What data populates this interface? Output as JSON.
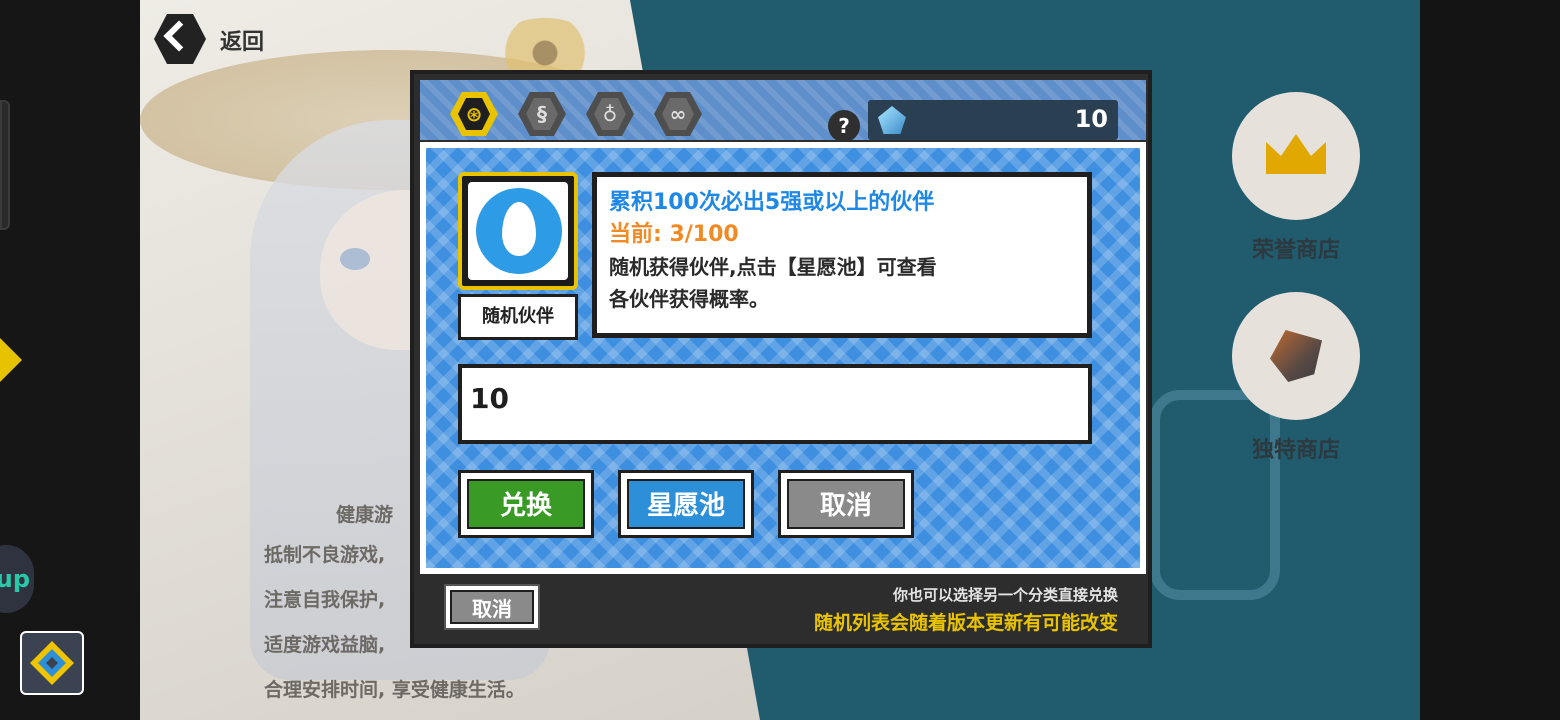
{
  "back": {
    "label": "返回"
  },
  "health_lines": [
    "健康游",
    "抵制不良游戏,",
    "注意自我保护,",
    "适度游戏益脑,",
    "合理安排时间, 享受健康生活。"
  ],
  "shops": [
    {
      "label": "荣誉商店",
      "icon": "crown-icon"
    },
    {
      "label": "独特商店",
      "icon": "ore-icon"
    }
  ],
  "side": {
    "float_text": "up"
  },
  "dialog": {
    "tabs": [
      {
        "name": "tab-general",
        "glyph": "⊛",
        "active": true
      },
      {
        "name": "tab-dragon",
        "glyph": "§",
        "active": false
      },
      {
        "name": "tab-bag",
        "glyph": "♁",
        "active": false
      },
      {
        "name": "tab-infinity",
        "glyph": "∞",
        "active": false
      }
    ],
    "help": "?",
    "currency": {
      "icon": "crystal-icon",
      "value": "10"
    },
    "item": {
      "label": "随机伙伴",
      "icon": "egg-icon"
    },
    "info": {
      "line1": "累积100次必出5强或以上的伙伴",
      "line2": "当前: 3/100",
      "line3": "随机获得伙伴,点击【星愿池】可查看",
      "line4": "各伙伴获得概率。"
    },
    "quantity_input": {
      "value": "10"
    },
    "buttons": {
      "exchange": "兑换",
      "wish_pool": "星愿池",
      "cancel": "取消"
    },
    "bottom": {
      "cancel": "取消",
      "note1": "你也可以选择另一个分类直接兑换",
      "note2": "随机列表会随着版本更新有可能改变"
    }
  },
  "colors": {
    "exchange_green": "#3a9a26",
    "wish_blue": "#2d8fd8",
    "cancel_gray": "#8a8a8a",
    "accent_yellow": "#e9c300",
    "info_blue": "#1f88e5",
    "info_orange": "#f08a24"
  }
}
